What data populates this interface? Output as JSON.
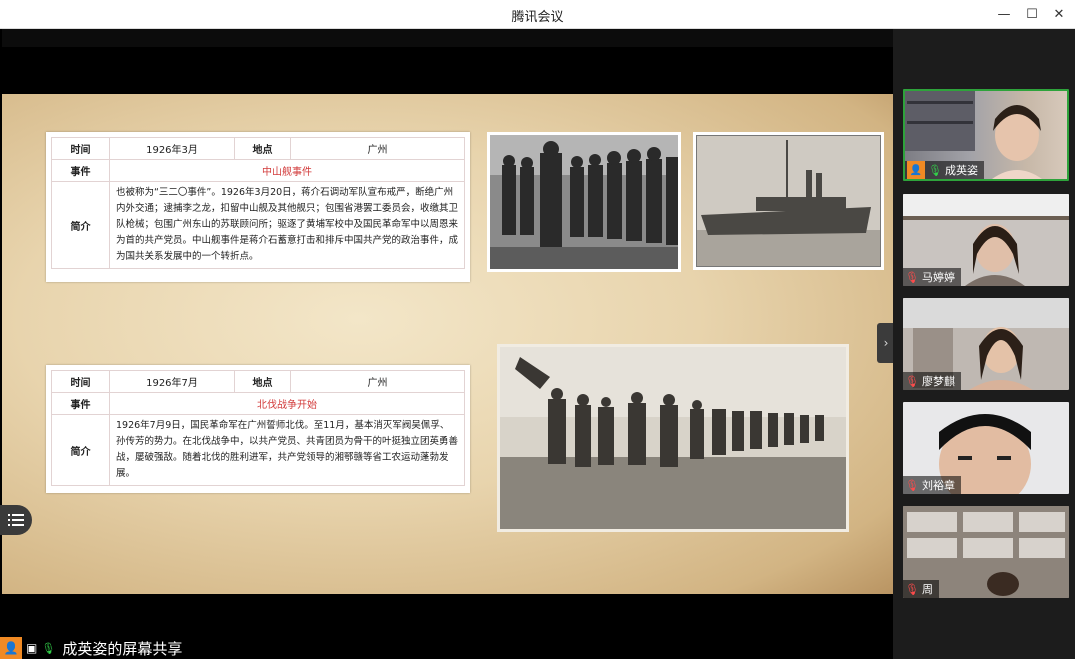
{
  "window": {
    "title": "腾讯会议",
    "minimize_icon": "—",
    "maximize_icon": "☐",
    "close_icon": "✕"
  },
  "share": {
    "label": "成英姿的屏幕共享"
  },
  "slide": {
    "card1": {
      "time_label": "时间",
      "time": "1926年3月",
      "place_label": "地点",
      "place": "广州",
      "event_label": "事件",
      "event": "中山舰事件",
      "summary_label": "简介",
      "summary": "也被称为“三二〇事件”。1926年3月20日，蒋介石调动军队宣布戒严，断绝广州内外交通；逮捕李之龙，扣留中山舰及其他舰只；包围省港罢工委员会，收缴其卫队枪械；包围广州东山的苏联顾问所；驱逐了黄埔军校中及国民革命军中以周恩来为首的共产党员。中山舰事件是蒋介石蓄意打击和排斥中国共产党的政治事件，成为国共关系发展中的一个转折点。"
    },
    "card2": {
      "time_label": "时间",
      "time": "1926年7月",
      "place_label": "地点",
      "place": "广州",
      "event_label": "事件",
      "event": "北伐战争开始",
      "summary_label": "简介",
      "summary": "1926年7月9日，国民革命军在广州誓师北伐。至11月，基本消灭军阀吴佩孚、孙传芳的势力。在北伐战争中，以共产党员、共青团员为骨干的叶挺独立团英勇善战，屡破强敌。随着北伐的胜利进军，共产党领导的湘鄂赣等省工农运动蓬勃发展。"
    }
  },
  "participants": [
    {
      "name": "成英姿",
      "mic": "on",
      "active": true
    },
    {
      "name": "马婷婷",
      "mic": "off",
      "active": false
    },
    {
      "name": "廖梦麒",
      "mic": "off",
      "active": false
    },
    {
      "name": "刘裕章",
      "mic": "off",
      "active": false
    },
    {
      "name": "周",
      "mic": "off",
      "active": false
    }
  ]
}
